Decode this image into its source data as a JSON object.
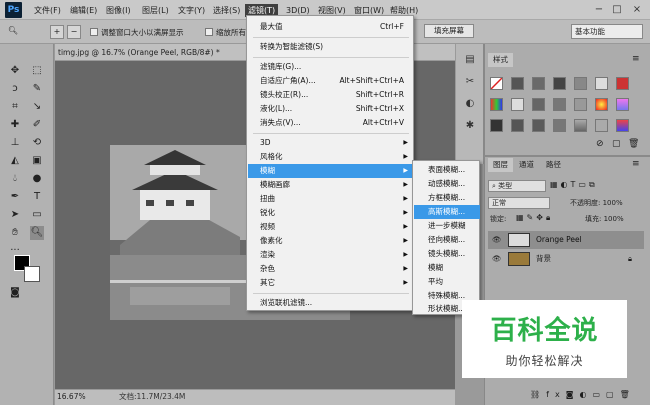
{
  "app": {
    "logo": "Ps"
  },
  "menubar": [
    {
      "id": "file",
      "label": "文件(F)"
    },
    {
      "id": "edit",
      "label": "编辑(E)"
    },
    {
      "id": "image",
      "label": "图像(I)"
    },
    {
      "id": "layer",
      "label": "图层(L)"
    },
    {
      "id": "type",
      "label": "文字(Y)"
    },
    {
      "id": "select",
      "label": "选择(S)"
    },
    {
      "id": "filter",
      "label": "滤镜(T)"
    },
    {
      "id": "3d",
      "label": "3D(D)"
    },
    {
      "id": "view",
      "label": "视图(V)"
    },
    {
      "id": "window",
      "label": "窗口(W)"
    },
    {
      "id": "help",
      "label": "帮助(H)"
    }
  ],
  "options": {
    "resize_windows": "调整窗口大小以满屏显示",
    "zoom_all": "缩放所有窗口",
    "fill_screen": "填充屏幕",
    "workspace": "基本功能"
  },
  "document": {
    "tab": "timg.jpg @ 16.7% (Orange Peel, RGB/8#) *",
    "zoom": "16.67%",
    "size": "文档:11.7M/23.4M"
  },
  "filter_menu": [
    {
      "label": "最大值",
      "shortcut": "Ctrl+F"
    },
    {
      "label": "转换为智能滤镜(S)",
      "shortcut": ""
    },
    {
      "label": "滤镜库(G)...",
      "shortcut": ""
    },
    {
      "label": "自适应广角(A)...",
      "shortcut": "Alt+Shift+Ctrl+A"
    },
    {
      "label": "镜头校正(R)...",
      "shortcut": "Shift+Ctrl+R"
    },
    {
      "label": "液化(L)...",
      "shortcut": "Shift+Ctrl+X"
    },
    {
      "label": "消失点(V)...",
      "shortcut": "Alt+Ctrl+V"
    },
    {
      "label": "3D",
      "shortcut": ""
    },
    {
      "label": "风格化",
      "shortcut": ""
    },
    {
      "label": "模糊",
      "shortcut": ""
    },
    {
      "label": "模糊画廊",
      "shortcut": ""
    },
    {
      "label": "扭曲",
      "shortcut": ""
    },
    {
      "label": "锐化",
      "shortcut": ""
    },
    {
      "label": "视频",
      "shortcut": ""
    },
    {
      "label": "像素化",
      "shortcut": ""
    },
    {
      "label": "渲染",
      "shortcut": ""
    },
    {
      "label": "杂色",
      "shortcut": ""
    },
    {
      "label": "其它",
      "shortcut": ""
    },
    {
      "label": "浏览联机滤镜...",
      "shortcut": ""
    }
  ],
  "blur_submenu": [
    "表面模糊...",
    "动感模糊...",
    "方框模糊...",
    "高斯模糊...",
    "进一步模糊",
    "径向模糊...",
    "镜头模糊...",
    "模糊",
    "平均",
    "特殊模糊...",
    "形状模糊..."
  ],
  "panels": {
    "styles_tab": "样式",
    "layers_tabs": [
      "图层",
      "通道",
      "路径"
    ],
    "kind": "类型",
    "blend": "正常",
    "opacity": "不透明度: 100%",
    "lock": "锁定:",
    "fill": "填充: 100%",
    "layers": [
      {
        "name": "Orange Peel"
      },
      {
        "name": "背景"
      }
    ]
  },
  "watermark": {
    "main": "百科全说",
    "sub": "助你轻松解决"
  },
  "colors": {
    "accent": "#3a99e8",
    "brand_green": "#2db04a"
  }
}
